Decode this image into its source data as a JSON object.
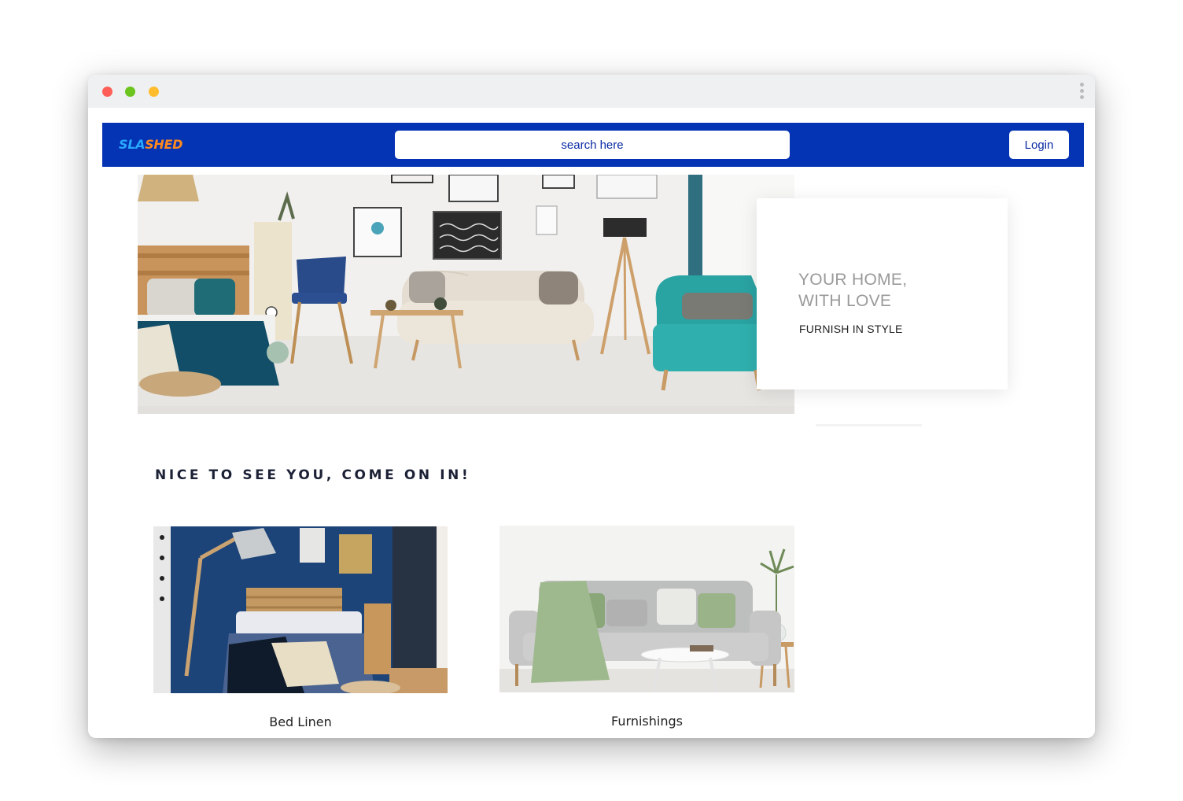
{
  "window": {
    "controls": [
      {
        "name": "close",
        "color": "#ff5f57"
      },
      {
        "name": "minimize",
        "color": "#6cc51e"
      },
      {
        "name": "zoom",
        "color": "#ffbd2e"
      }
    ]
  },
  "navbar": {
    "background": "#0433b3",
    "logo": {
      "part1": "SLA",
      "part2": "SHED",
      "colors": [
        "#29a8ff",
        "#ff8a1f"
      ]
    },
    "search": {
      "placeholder": "search here",
      "value": ""
    },
    "login_label": "Login"
  },
  "hero": {
    "image": "living-room-photo",
    "title": "YOUR HOME,\nWITH LOVE",
    "subtitle": "FURNISH IN STYLE"
  },
  "welcome": {
    "heading": "NICE TO SEE YOU, COME ON IN!"
  },
  "categories": [
    {
      "label": "Bed Linen",
      "image": "bedroom-photo"
    },
    {
      "label": "Furnishings",
      "image": "sofa-photo"
    }
  ]
}
